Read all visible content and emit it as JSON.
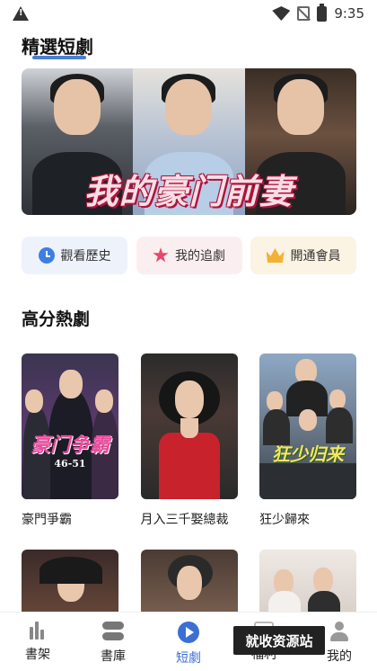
{
  "status_bar": {
    "time": "9:35"
  },
  "featured": {
    "title": "精選短劇",
    "banner_text": "我的豪门前妻"
  },
  "quick_actions": [
    {
      "label": "觀看歷史",
      "icon": "clock-icon"
    },
    {
      "label": "我的追劇",
      "icon": "star-icon"
    },
    {
      "label": "開通會員",
      "icon": "vip-crown-icon"
    }
  ],
  "hot": {
    "title": "高分熱劇",
    "cards": [
      {
        "title": "豪門爭霸",
        "poster_text": "豪门争霸",
        "poster_sub": "46-51"
      },
      {
        "title": "月入三千娶總裁",
        "poster_text": ""
      },
      {
        "title": "狂少歸來",
        "poster_text": "狂少归来"
      }
    ]
  },
  "tabbar": {
    "items": [
      {
        "label": "書架",
        "icon": "bookshelf-icon"
      },
      {
        "label": "書庫",
        "icon": "library-icon"
      },
      {
        "label": "短劇",
        "icon": "play-icon",
        "active": true
      },
      {
        "label": "福利",
        "icon": "gift-icon"
      },
      {
        "label": "我的",
        "icon": "user-icon"
      }
    ]
  },
  "watermark": "就收资源站",
  "colors": {
    "accent": "#3b6fd6",
    "underline": "#4a7fd1"
  }
}
